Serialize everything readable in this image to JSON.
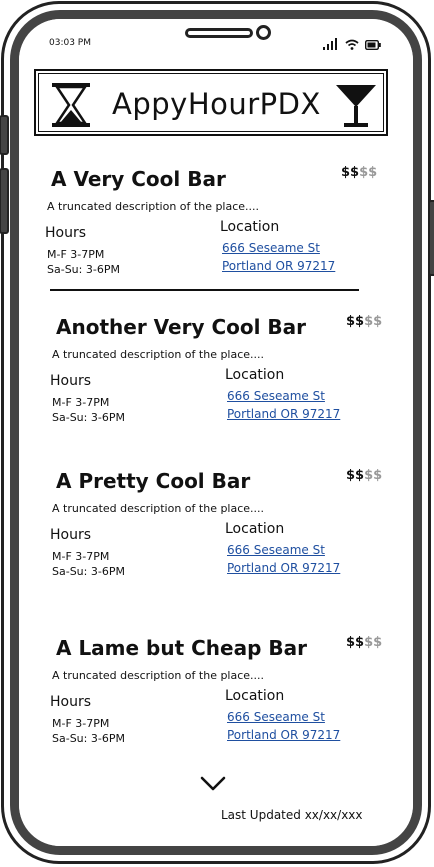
{
  "status_bar": {
    "time": "03:03 PM",
    "icons": [
      "signal-icon",
      "wifi-icon",
      "battery-icon"
    ]
  },
  "header": {
    "title": "AppyHourPDX",
    "left_icon": "hourglass-icon",
    "right_icon": "martini-glass-icon"
  },
  "bars": [
    {
      "name": "A Very Cool Bar",
      "price_paid": "$$",
      "price_unpaid": "$$",
      "description": "A truncated description of the place....",
      "hours_label": "Hours",
      "hours": [
        "M-F 3-7PM",
        "Sa-Su: 3-6PM"
      ],
      "location_label": "Location",
      "address_line1": "666 Seseame St",
      "address_line2": "Portland OR 97217"
    },
    {
      "name": "Another Very Cool Bar",
      "price_paid": "$$",
      "price_unpaid": "$$",
      "description": "A truncated description of the place....",
      "hours_label": "Hours",
      "hours": [
        "M-F 3-7PM",
        "Sa-Su: 3-6PM"
      ],
      "location_label": "Location",
      "address_line1": "666 Seseame St",
      "address_line2": "Portland OR 97217"
    },
    {
      "name": "A Pretty Cool Bar",
      "price_paid": "$$",
      "price_unpaid": "$$",
      "description": "A truncated description of the place....",
      "hours_label": "Hours",
      "hours": [
        "M-F 3-7PM",
        "Sa-Su: 3-6PM"
      ],
      "location_label": "Location",
      "address_line1": "666 Seseame St",
      "address_line2": "Portland OR 97217"
    },
    {
      "name": "A Lame but Cheap Bar",
      "price_paid": "$$",
      "price_unpaid": "$$",
      "description": "A truncated description of the place....",
      "hours_label": "Hours",
      "hours": [
        "M-F 3-7PM",
        "Sa-Su: 3-6PM"
      ],
      "location_label": "Location",
      "address_line1": "666 Seseame St",
      "address_line2": "Portland OR 97217"
    }
  ],
  "footer": {
    "more_icon": "chevron-down-icon",
    "last_updated": "Last Updated xx/xx/xxx"
  },
  "colors": {
    "link": "#1f4fa0",
    "price_unpaid": "#999999",
    "frame": "#444444"
  }
}
